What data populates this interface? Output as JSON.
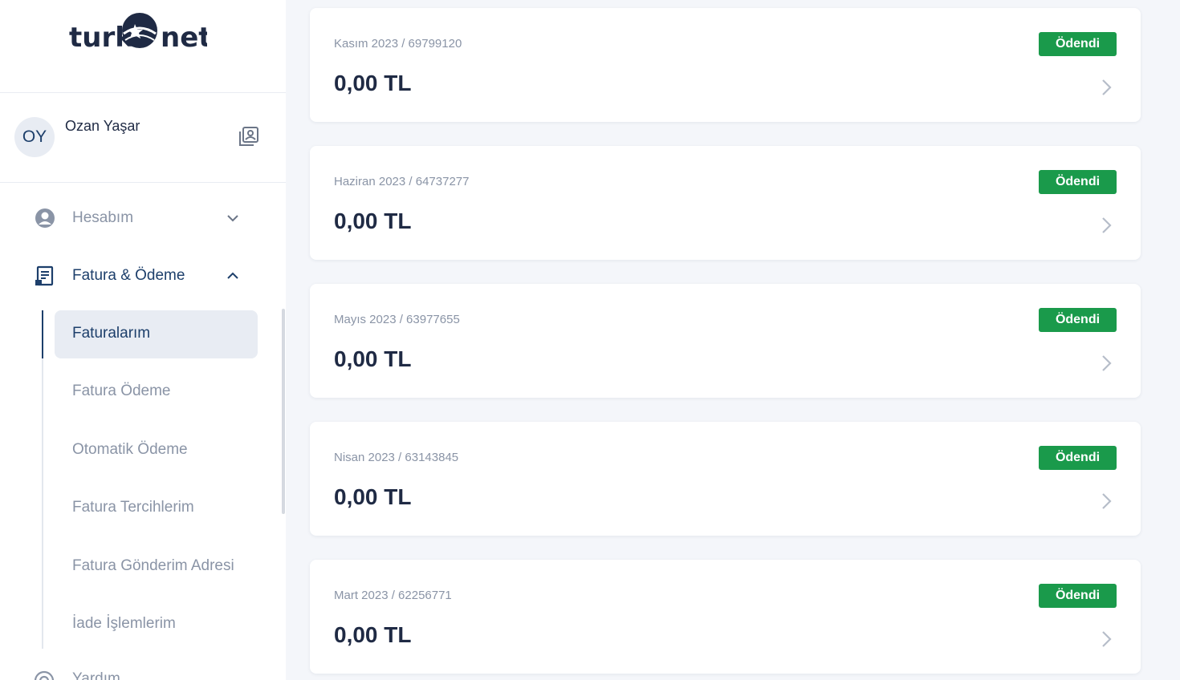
{
  "brand": {
    "logo_text_left": "turk",
    "logo_text_right": "net"
  },
  "user": {
    "initials": "OY",
    "name": "Ozan Yaşar"
  },
  "nav": {
    "account_label": "Hesabım",
    "billing_label": "Fatura & Ödeme",
    "sub_items": [
      {
        "label": "Faturalarım",
        "active": true
      },
      {
        "label": "Fatura Ödeme",
        "active": false
      },
      {
        "label": "Otomatik Ödeme",
        "active": false
      },
      {
        "label": "Fatura Tercihlerim",
        "active": false
      },
      {
        "label": "Fatura Gönderim Adresi",
        "active": false
      },
      {
        "label": "İade İşlemlerim",
        "active": false
      }
    ],
    "next_item_label": "Yardım"
  },
  "invoices": [
    {
      "period": "Kasım 2023 / 69799120",
      "amount": "0,00 TL",
      "status": "Ödendi"
    },
    {
      "period": "Haziran 2023 / 64737277",
      "amount": "0,00 TL",
      "status": "Ödendi"
    },
    {
      "period": "Mayıs 2023 / 63977655",
      "amount": "0,00 TL",
      "status": "Ödendi"
    },
    {
      "period": "Nisan 2023 / 63143845",
      "amount": "0,00 TL",
      "status": "Ödendi"
    },
    {
      "period": "Mart 2023 / 62256771",
      "amount": "0,00 TL",
      "status": "Ödendi"
    }
  ],
  "colors": {
    "primary": "#1d3f6b",
    "paid_badge": "#1a9a4b",
    "muted_text": "#8a94a6",
    "page_bg": "#f4f6fa"
  }
}
